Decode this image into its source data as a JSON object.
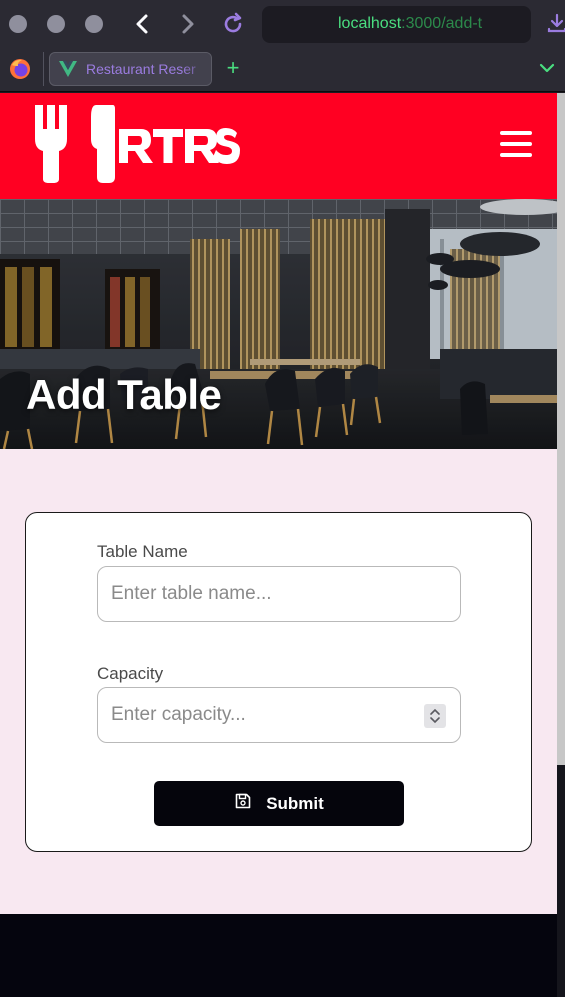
{
  "browser": {
    "url_host": "localhost",
    "url_path": ":3000/add-t",
    "tab_title": "Restaurant Reser",
    "new_tab_symbol": "+",
    "icons": [
      "firefox-icon",
      "vue-icon",
      "back-icon",
      "forward-icon",
      "reload-icon",
      "download-icon",
      "tab-list-icon"
    ]
  },
  "header": {
    "logo_text": "RTRS",
    "menu_icon": "hamburger-icon",
    "brand_color": "#ff0022"
  },
  "hero": {
    "title": "Add Table"
  },
  "form": {
    "table_name_label": "Table Name",
    "table_name_placeholder": "Enter table name...",
    "table_name_value": "",
    "capacity_label": "Capacity",
    "capacity_placeholder": "Enter capacity...",
    "capacity_value": "",
    "submit_label": "Submit",
    "submit_icon": "save-icon"
  },
  "colors": {
    "page_background": "#f8e8f1",
    "button": "#05050c",
    "footer": "#05050e"
  }
}
